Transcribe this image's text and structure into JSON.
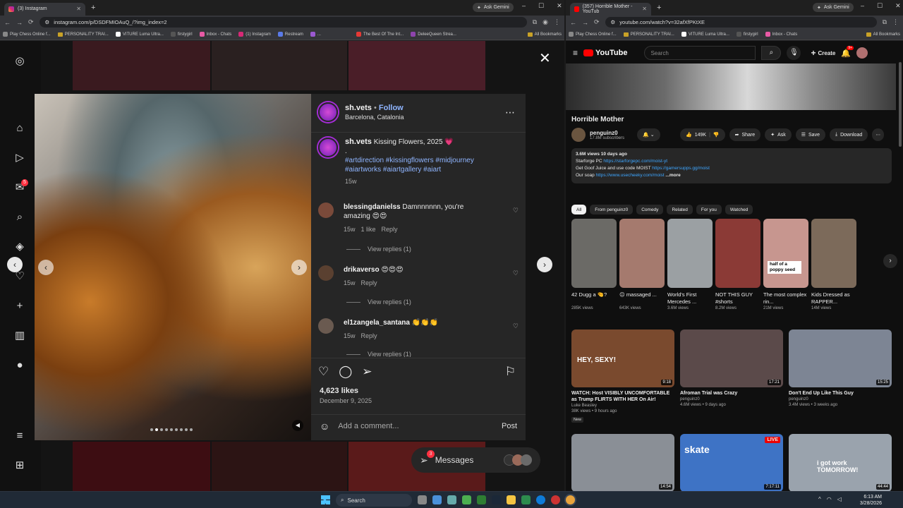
{
  "left_browser": {
    "tab_title": "(3) Instagram",
    "gemini": "Ask Gemini",
    "url": "instagram.com/p/DSDFMIOAuQ_/?img_index=2",
    "bookmarks": [
      "Play Chess Online f...",
      "PERSONALITY TRAI...",
      "VITURE Luma Ultra...",
      "firstygirl",
      "Inbox - Chats",
      "(1) Instagram",
      "Restream",
      "...",
      "The Best Of The Int...",
      "DeleeQueen Strea..."
    ],
    "all_bookmarks": "All Bookmarks"
  },
  "right_browser": {
    "tab_title": "(357) Horrible Mother - YouTub",
    "gemini": "Ask Gemini",
    "url": "youtube.com/watch?v=32afXfPKtXE",
    "bookmarks": [
      "Play Chess Online f...",
      "PERSONALITY TRAI...",
      "VITURE Luma Ultra...",
      "firstygirl",
      "Inbox - Chats"
    ],
    "all_bookmarks": "All Bookmarks"
  },
  "instagram": {
    "notif_count": "5",
    "post": {
      "username": "sh.vets",
      "follow": "Follow",
      "location": "Barcelona, Catalonia",
      "caption_user": "sh.vets",
      "caption_text": "Kissing Flowers, 2025 💗",
      "caption_dot": ".",
      "hashtags1": "#artdirection #kissingflowers #midjourney",
      "hashtags2": "#aiartworks #aiartgallery #aiart",
      "caption_age": "15w",
      "likes": "4,623 likes",
      "date": "December 9, 2025",
      "add_comment": "Add a comment...",
      "post_btn": "Post"
    },
    "comments": [
      {
        "user": "blessingdanielss",
        "text": "Damnnnnnn, you're amazing 😍😍",
        "age": "15w",
        "likes": "1 like",
        "reply": "Reply",
        "view": "View replies (1)"
      },
      {
        "user": "drikaverso",
        "text": "😍😍😍",
        "age": "15w",
        "likes": "",
        "reply": "Reply",
        "view": "View replies (1)"
      },
      {
        "user": "el1zangela_santana",
        "text": "👏👏👏",
        "age": "15w",
        "likes": "",
        "reply": "Reply",
        "view": "View replies (1)"
      }
    ],
    "messages": "Messages",
    "messages_badge": "3"
  },
  "youtube": {
    "search_placeholder": "Search",
    "create": "Create",
    "notif": "9+",
    "video_title": "Horrible Mother",
    "channel": "penguinz0",
    "subs": "17.8M subscribers",
    "likes": "149K",
    "share": "Share",
    "ask": "Ask",
    "save": "Save",
    "download": "Download",
    "desc_stats": "3.6M views  10 days ago",
    "desc_l1_pre": "Starforge PC ",
    "desc_l1_link": "https://starforgepc.com/moist-yt",
    "desc_l2_pre": "Get Goof Juice and use code MOIST ",
    "desc_l2_link": "https://gamersupps.gg/moist",
    "desc_l3_pre": "Our soap ",
    "desc_l3_link": "https://www.usecheeky.com/moist",
    "desc_more": "...more",
    "chips": [
      "All",
      "From penguinz0",
      "Comedy",
      "Related",
      "For you",
      "Watched"
    ],
    "shorts": [
      {
        "title": "42 Dugg a 🤏?",
        "views": "285K views",
        "color": "#6b6a66"
      },
      {
        "title": "😐 massaged ...",
        "views": "643K views",
        "color": "#a57a6e"
      },
      {
        "title": "World's First Mercedes ...",
        "views": "3.6M views",
        "color": "#9ba0a3"
      },
      {
        "title": "NOT THIS GUY #shorts",
        "views": "8.2M views",
        "color": "#8b3a36"
      },
      {
        "title": "The most complex rin...",
        "views": "21M views",
        "color": "#c7968f"
      },
      {
        "title": "Kids Dressed as RAPPER...",
        "views": "14M views",
        "color": "#7c6a5a"
      }
    ],
    "videos": [
      {
        "title": "WATCH: Host VISIBLY UNCOMFORTABLE as Trump FLIRTS WITH HER On Air!",
        "channel": "Luke Beasley",
        "meta": "38K views • 9 hours ago",
        "badge": "New",
        "dur": "9:18",
        "color": "#7a4a2e",
        "overlay": "HEY, SEXY!"
      },
      {
        "title": "Afroman Trial was Crazy",
        "channel": "penguinz0",
        "meta": "4.6M views • 9 days ago",
        "badge": "",
        "dur": "17:21",
        "color": "#5b4a4a",
        "overlay": ""
      },
      {
        "title": "Don't End Up Like This Guy",
        "channel": "penguinz0",
        "meta": "3.4M views • 3 weeks ago",
        "badge": "",
        "dur": "15:25",
        "color": "#7d8594",
        "overlay": ""
      },
      {
        "title": "",
        "channel": "",
        "meta": "",
        "badge": "",
        "dur": "14:54",
        "color": "#8a8f96",
        "overlay": ""
      },
      {
        "title": "",
        "channel": "",
        "meta": "",
        "badge": "",
        "dur": "7:17:11",
        "color": "#3e73c5",
        "overlay": "skate"
      },
      {
        "title": "",
        "channel": "",
        "meta": "",
        "badge": "",
        "dur": "44:44",
        "color": "#9aa3ad",
        "overlay": "i got work TOMORROW!"
      }
    ],
    "shorts_overlay": "half of a poppy seed",
    "live": "LIVE"
  },
  "taskbar": {
    "search": "Search",
    "time": "6:13 AM",
    "date": "3/28/2026"
  }
}
